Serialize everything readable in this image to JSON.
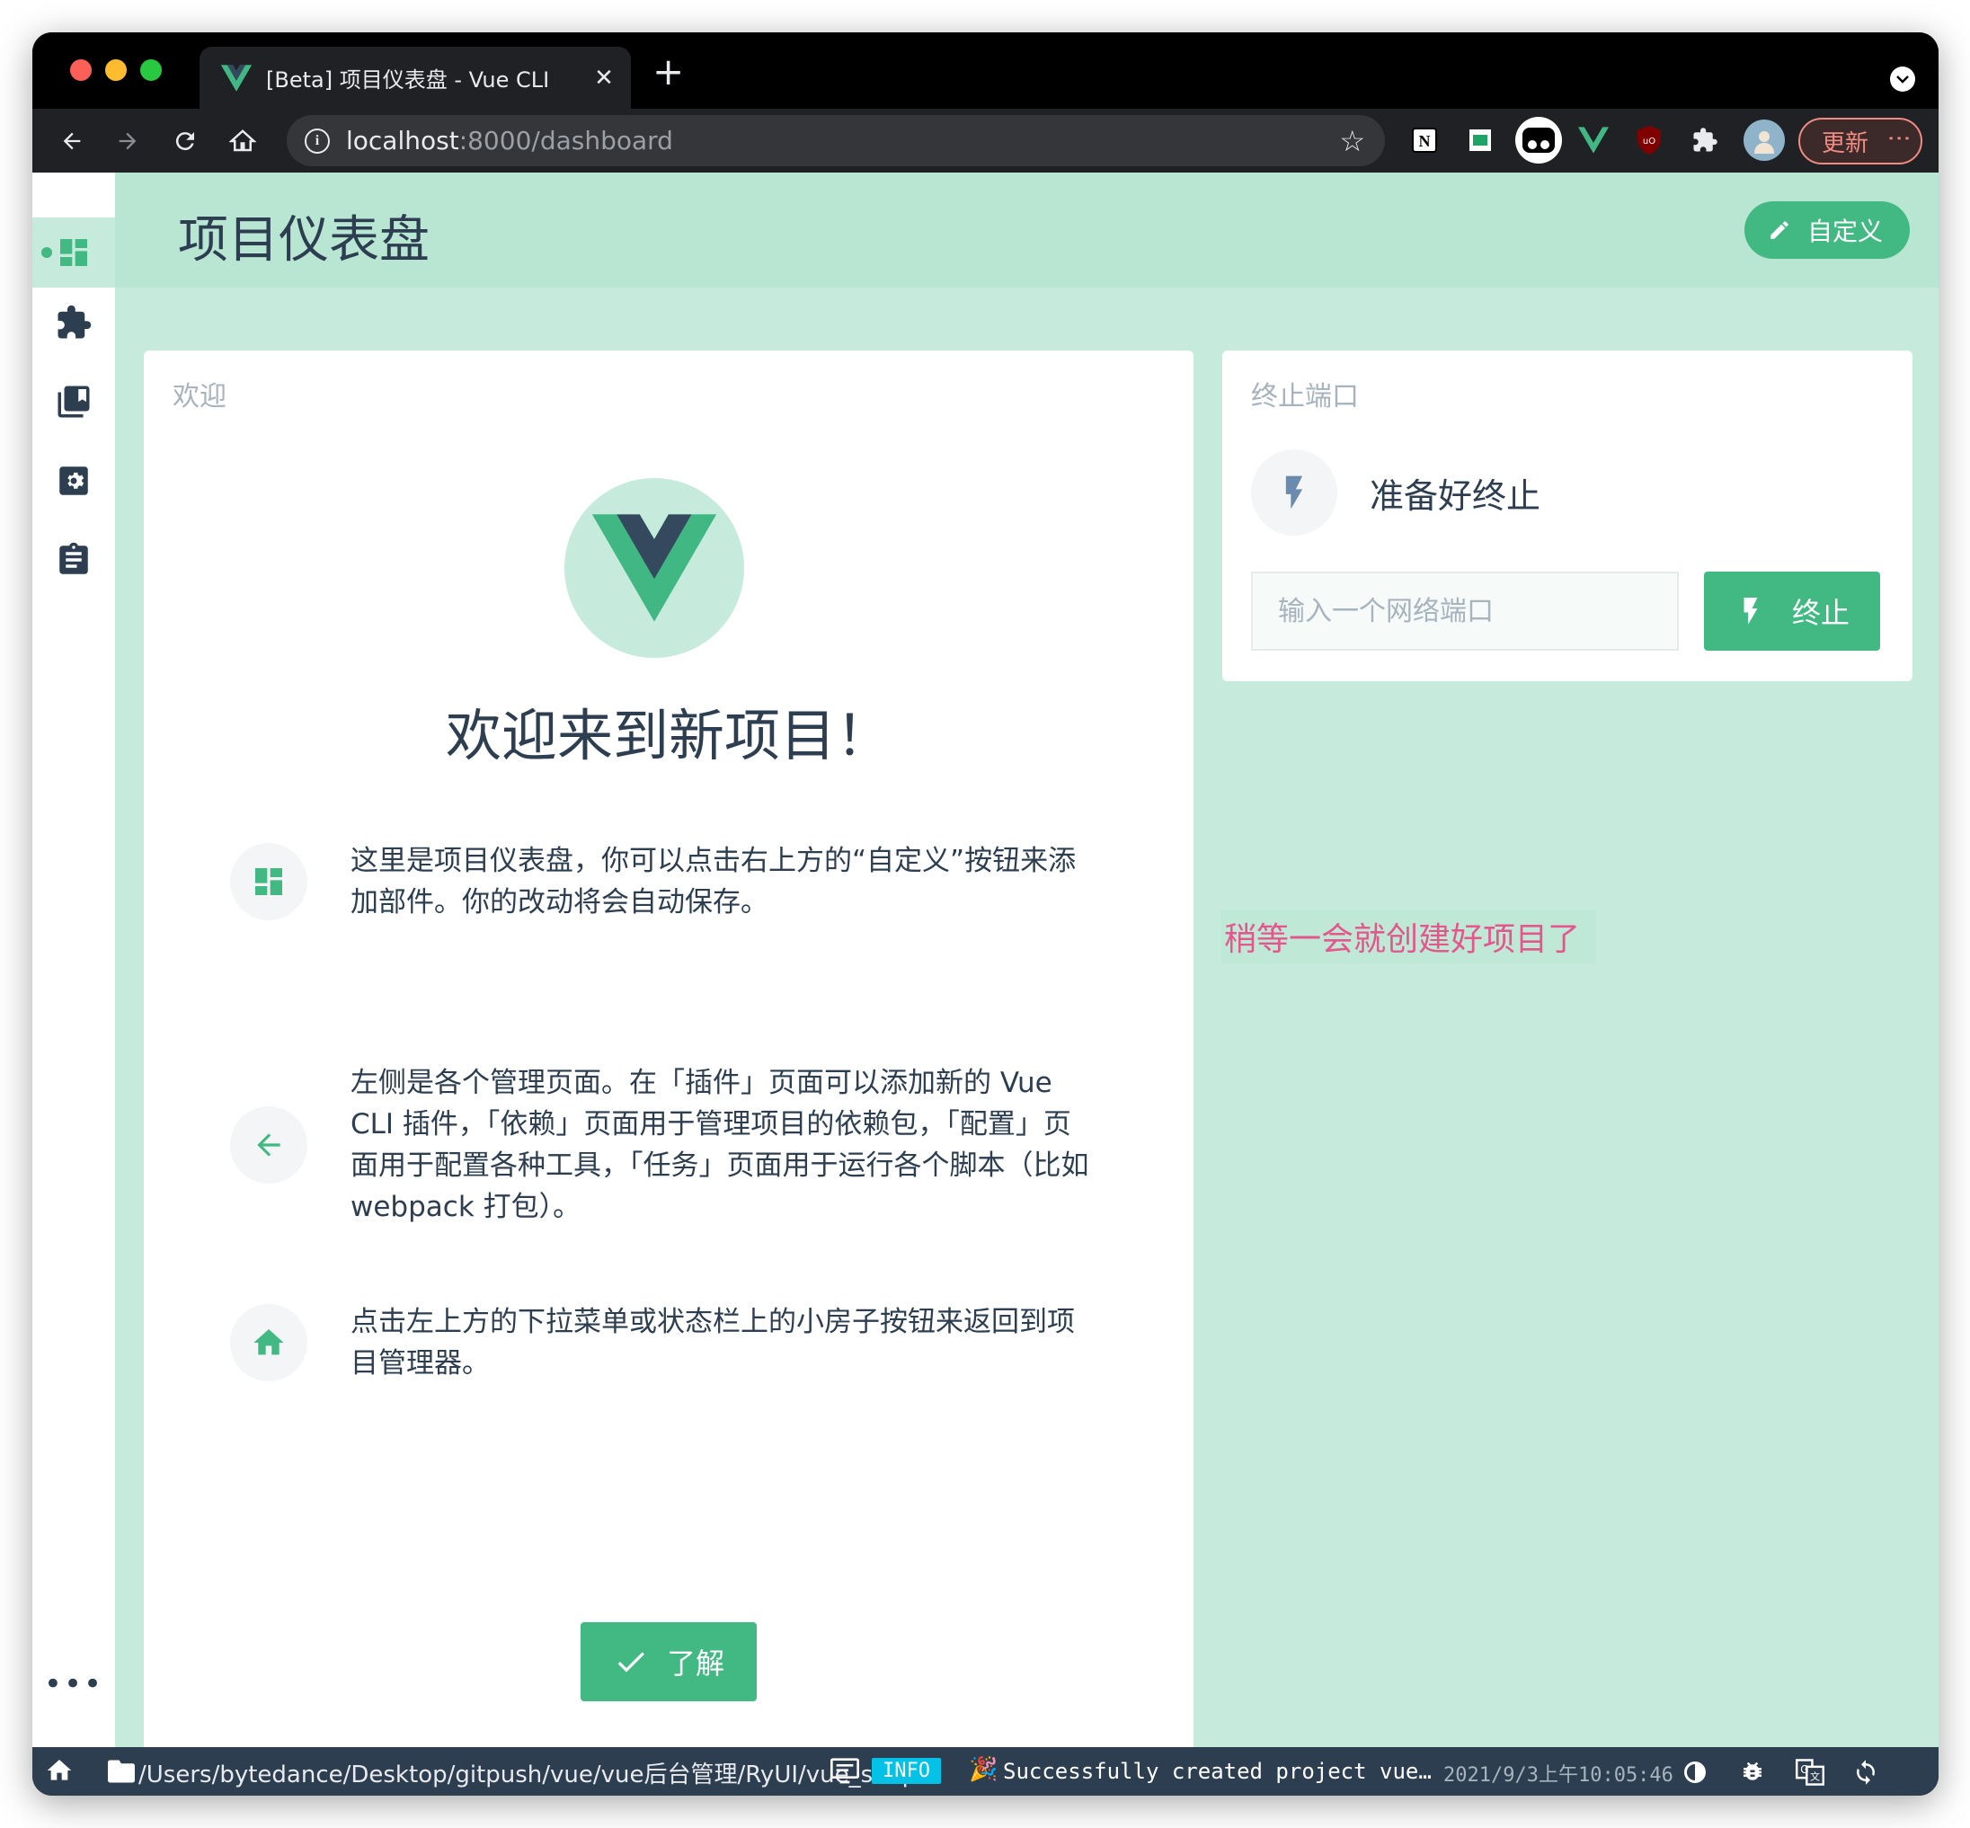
{
  "browser": {
    "tab_title": "[Beta] 项目仪表盘 - Vue CLI",
    "tab_close": "✕",
    "new_tab": "+",
    "url_host": "localhost",
    "url_path": ":8000/dashboard",
    "update_label": "更新"
  },
  "header": {
    "title": "项目仪表盘",
    "customize_label": "自定义"
  },
  "sidebar": {
    "items": [
      {
        "name": "dashboard",
        "icon": "dashboard-icon",
        "active": true
      },
      {
        "name": "plugins",
        "icon": "puzzle-icon",
        "active": false
      },
      {
        "name": "dependencies",
        "icon": "library-books-icon",
        "active": false
      },
      {
        "name": "configuration",
        "icon": "settings-icon",
        "active": false
      },
      {
        "name": "tasks",
        "icon": "clipboard-icon",
        "active": false
      }
    ],
    "more": "•••"
  },
  "welcome": {
    "card_title": "欢迎",
    "heading": "欢迎来到新项目！",
    "tips": [
      {
        "icon": "dashboard-icon",
        "text": "这里是项目仪表盘，你可以点击右上方的“自定义”按钮来添加部件。你的改动将会自动保存。"
      },
      {
        "icon": "arrow-left-icon",
        "text": "左侧是各个管理页面。在「插件」页面可以添加新的 Vue CLI 插件，「依赖」页面用于管理项目的依赖包，「配置」页面用于配置各种工具，「任务」页面用于运行各个脚本（比如 webpack 打包）。"
      },
      {
        "icon": "home-icon",
        "text": "点击左上方的下拉菜单或状态栏上的小房子按钮来返回到项目管理器。"
      }
    ],
    "ok_label": "了解"
  },
  "kill_port": {
    "card_title": "终止端口",
    "status": "准备好终止",
    "input_placeholder": "输入一个网络端口",
    "input_value": "",
    "button_label": "终止"
  },
  "annotation": "稍等一会就创建好项目了",
  "statusbar": {
    "path": "/Users/bytedance/Desktop/gitpush/vue/vue后台管理/RyUI/vue_shop",
    "log_level": "INFO",
    "log_emoji": "🎉",
    "log_message": "Successfully created project vue…",
    "log_time": "2021/9/3上午10:05:46"
  },
  "colors": {
    "accent": "#42b983",
    "background": "#c6ebdd",
    "text": "#2c3e50",
    "annotation": "#e4578c",
    "info_badge": "#03c2e6"
  }
}
